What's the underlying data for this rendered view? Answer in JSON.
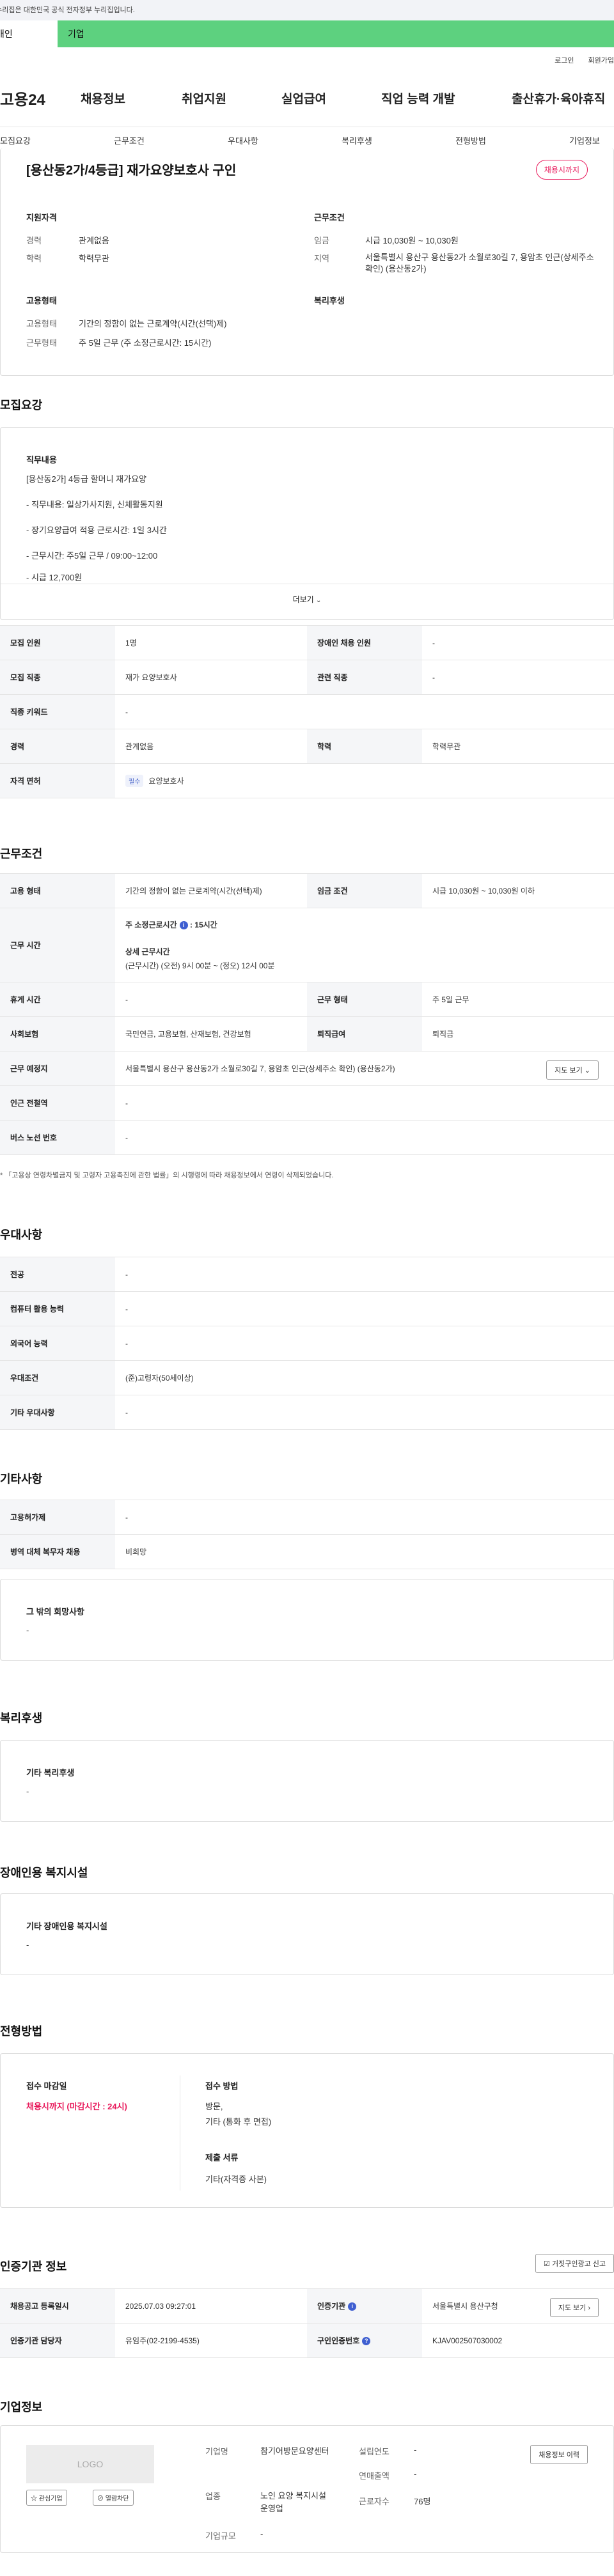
{
  "gov_banner": "이 누리집은 대한민국 공식 전자정부 누리집입니다.",
  "top_tabs": {
    "personal": "개인",
    "company": "기업"
  },
  "util_links": [
    "로그인",
    "회원가입"
  ],
  "logo": "고용24",
  "gnb": [
    "채용정보",
    "취업지원",
    "실업급여",
    "직업 능력 개발",
    "출산휴가·육아휴직"
  ],
  "subnav": [
    "모집요강",
    "근무조건",
    "우대사항",
    "복리후생",
    "전형방법",
    "기업정보"
  ],
  "summary": {
    "title": "[용산동2가/4등급] 재가요양보호사 구인",
    "status_badge": "채용시까지",
    "qualification_head": "지원자격",
    "career_label": "경력",
    "career_value": "관계없음",
    "education_label": "학력",
    "education_value": "학력무관",
    "employment_head": "고용형태",
    "emp_type_label": "고용형태",
    "emp_type_value": "기간의 정함이 없는 근로계약(시간(선택)제)",
    "work_form_label": "근무형태",
    "work_form_value": "주 5일 근무 (주 소정근로시간: 15시간)",
    "conditions_head": "근무조건",
    "wage_label": "임금",
    "wage_value": "시급 10,030원 ~ 10,030원",
    "region_label": "지역",
    "region_value": "서울특별시 용산구 용산동2가 소월로30길 7, 용암초 인근(상세주소 확인) (용산동2가)",
    "welfare_head": "복리후생"
  },
  "recruit": {
    "section_title": "모집요강",
    "duty_head": "직무내용",
    "duty_lines": [
      "[용산동2가] 4등급 할머니 재가요양",
      "- 직무내용: 일상가사지원, 신체활동지원",
      "- 장기요양급여 적용 근로시간: 1일 3시간",
      "- 근무시간: 주5일 근무 / 09:00~12:00",
      "- 시급 12,700원"
    ],
    "more_label": "더보기",
    "table": {
      "recruit_count_label": "모집 인원",
      "recruit_count_value": "1명",
      "disabled_label": "장애인 채용 인원",
      "disabled_value": "-",
      "job_label": "모집 직종",
      "job_value": "재가 요양보호사",
      "related_job_label": "관련 직종",
      "related_job_value": "-",
      "keyword_label": "직종 키워드",
      "keyword_value": "-",
      "career_label": "경력",
      "career_value": "관계없음",
      "edu_label": "학력",
      "edu_value": "학력무관",
      "license_label": "자격 면허",
      "license_tag": "필수",
      "license_value": "요양보호사"
    }
  },
  "conditions": {
    "section_title": "근무조건",
    "emp_type_label": "고용 형태",
    "emp_type_value": "기간의 정함이 없는 근로계약(시간(선택)제)",
    "wage_label": "임금 조건",
    "wage_value": "시급 10,030원 ~ 10,030원 이하",
    "hours_label": "근무 시간",
    "hours_weekly": "주 소정근로시간",
    "hours_weekly_value": "15시간",
    "hours_detail_head": "상세 근무시간",
    "hours_detail_value": "(근무시간) (오전) 9시 00분 ~ (정오) 12시 00분",
    "break_label": "휴게 시간",
    "break_value": "-",
    "work_form_label": "근무 형태",
    "work_form_value": "주 5일 근무",
    "insurance_label": "사회보험",
    "insurance_value": "국민연금, 고용보험, 산재보험, 건강보험",
    "retire_label": "퇴직급여",
    "retire_value": "퇴직금",
    "place_label": "근무 예정지",
    "place_value": "서울특별시 용산구 용산동2가 소월로30길 7, 용암초 인근(상세주소 확인) (용산동2가)",
    "map_button": "지도 보기",
    "subway_label": "인근 전철역",
    "subway_value": "-",
    "bus_label": "버스 노선 번호",
    "bus_value": "-",
    "note": "* 「고용상 연령차별금지 및 고령자 고용촉진에 관한 법률」의 시행령에 따라 채용정보에서 연령이 삭제되었습니다."
  },
  "preferences": {
    "section_title": "우대사항",
    "major_label": "전공",
    "major_value": "-",
    "computer_label": "컴퓨터 활용 능력",
    "computer_value": "-",
    "language_label": "외국어 능력",
    "language_value": "-",
    "pref_label": "우대조건",
    "pref_value": "(준)고령자(50세이상)",
    "other_label": "기타 우대사항",
    "other_value": "-"
  },
  "others": {
    "section_title": "기타사항",
    "permit_label": "고용허가제",
    "permit_value": "-",
    "military_label": "병역 대체 복무자 채용",
    "military_value": "비희망",
    "wish_head": "그 밖의 희망사항",
    "wish_value": "-"
  },
  "welfare": {
    "section_title": "복리후생",
    "head": "기타 복리후생",
    "value": "-"
  },
  "disability": {
    "section_title": "장애인용 복지시설",
    "head": "기타 장애인용 복지시설",
    "value": "-"
  },
  "selection": {
    "section_title": "전형방법",
    "deadline_head": "접수 마감일",
    "deadline_value": "채용시까지 (마감시간 : 24시)",
    "method_head": "접수 방법",
    "method_lines": [
      "방문,",
      "기타 (통화 후 면접)"
    ],
    "docs_head": "제출 서류",
    "docs_value": "기타(자격증 사본)"
  },
  "certification": {
    "section_title": "인증기관 정보",
    "report_button": "거짓구인광고 신고",
    "reg_date_label": "채용공고 등록일시",
    "reg_date_value": "2025.07.03 09:27:01",
    "agency_label": "인증기관",
    "agency_value": "서울특별시 용산구청",
    "map_button": "지도 보기",
    "manager_label": "인증기관 담당자",
    "manager_value": "유임주(02-2199-4535)",
    "cert_no_label": "구인인증번호",
    "cert_no_value": "KJAV002507030002"
  },
  "company": {
    "section_title": "기업정보",
    "logo_text": "LOGO",
    "interest_button": "관심기업",
    "block_button": "열람차단",
    "name_label": "기업명",
    "name_value": "참기어방문요양센터",
    "industry_label": "업종",
    "industry_value": "노인 요양 복지시설 운영업",
    "size_label": "기업규모",
    "size_value": "-",
    "founded_label": "설립연도",
    "founded_value": "-",
    "revenue_label": "연매출액",
    "revenue_value": "-",
    "employees_label": "근로자수",
    "employees_value": "76명",
    "history_button": "채용정보 이력"
  }
}
